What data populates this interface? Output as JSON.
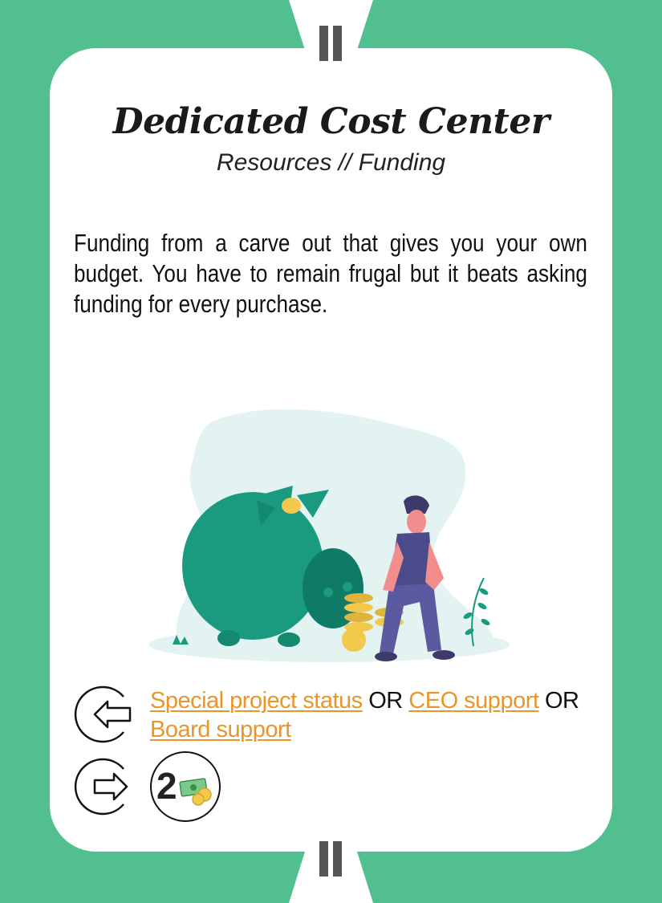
{
  "card": {
    "title": "Dedicated Cost Center",
    "subtitle": "Resources // Funding",
    "description": "Funding from a carve out that gives you your own budget. You have to remain frugal but it beats asking funding for every purchase.",
    "illustration_icon": "piggy-bank-person-coins-illustration"
  },
  "requirements": {
    "icon": "arrow-in-icon",
    "items": [
      {
        "label": "Special project status"
      },
      {
        "label": "CEO support"
      },
      {
        "label": "Board support"
      }
    ],
    "separator": "OR"
  },
  "reward": {
    "icon": "arrow-out-icon",
    "amount": "2",
    "resource_icon": "money-icon"
  },
  "colors": {
    "background": "#52bf90",
    "card": "#ffffff",
    "link": "#e8962b",
    "piggy": "#1a9a7f",
    "notch_bar": "#555555"
  }
}
